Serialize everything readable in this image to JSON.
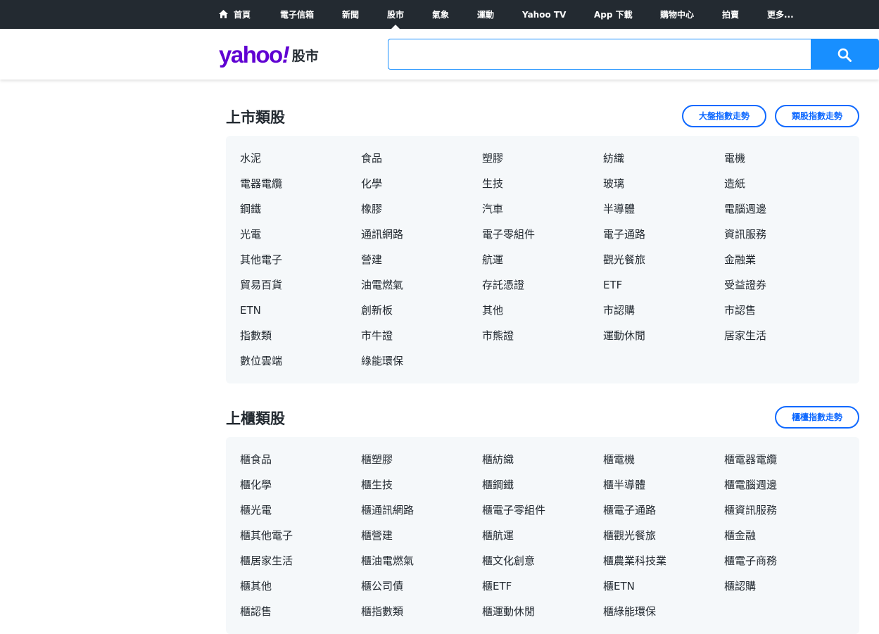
{
  "nav": {
    "items": [
      {
        "label": "首頁"
      },
      {
        "label": "電子信箱"
      },
      {
        "label": "新聞"
      },
      {
        "label": "股市"
      },
      {
        "label": "氣象"
      },
      {
        "label": "運動"
      },
      {
        "label": "Yahoo TV"
      },
      {
        "label": "App 下載"
      },
      {
        "label": "購物中心"
      },
      {
        "label": "拍賣"
      },
      {
        "label": "更多..."
      }
    ],
    "active": "股市"
  },
  "header": {
    "logo_word": "yahoo",
    "logo_bang": "!",
    "logo_sub": "股市",
    "search_value": "",
    "search_icon": "search-icon"
  },
  "listed": {
    "title": "上市類股",
    "buttons": [
      "大盤指數走勢",
      "類股指數走勢"
    ],
    "items": [
      "水泥",
      "食品",
      "塑膠",
      "紡織",
      "電機",
      "電器電纜",
      "化學",
      "生技",
      "玻璃",
      "造紙",
      "鋼鐵",
      "橡膠",
      "汽車",
      "半導體",
      "電腦週邊",
      "光電",
      "通訊網路",
      "電子零組件",
      "電子通路",
      "資訊服務",
      "其他電子",
      "營建",
      "航運",
      "觀光餐旅",
      "金融業",
      "貿易百貨",
      "油電燃氣",
      "存託憑證",
      "ETF",
      "受益證券",
      "ETN",
      "創新板",
      "其他",
      "市認購",
      "市認售",
      "指數類",
      "市牛證",
      "市熊證",
      "運動休閒",
      "居家生活",
      "數位雲端",
      "綠能環保"
    ]
  },
  "otc": {
    "title": "上櫃類股",
    "buttons": [
      "櫃檯指數走勢"
    ],
    "items": [
      "櫃食品",
      "櫃塑膠",
      "櫃紡織",
      "櫃電機",
      "櫃電器電纜",
      "櫃化學",
      "櫃生技",
      "櫃鋼鐵",
      "櫃半導體",
      "櫃電腦週邊",
      "櫃光電",
      "櫃通訊網路",
      "櫃電子零組件",
      "櫃電子通路",
      "櫃資訊服務",
      "櫃其他電子",
      "櫃營建",
      "櫃航運",
      "櫃觀光餐旅",
      "櫃金融",
      "櫃居家生活",
      "櫃油電燃氣",
      "櫃文化創意",
      "櫃農業科技業",
      "櫃電子商務",
      "櫃其他",
      "櫃公司債",
      "櫃ETF",
      "櫃ETN",
      "櫃認購",
      "櫃認售",
      "櫃指數類",
      "櫃運動休閒",
      "櫃綠能環保"
    ]
  },
  "colors": {
    "nav_bg": "#232a31",
    "brand": "#6001d2",
    "accent": "#188fff",
    "pill": "#0f69ff",
    "panel_bg": "#f5f8fa"
  }
}
